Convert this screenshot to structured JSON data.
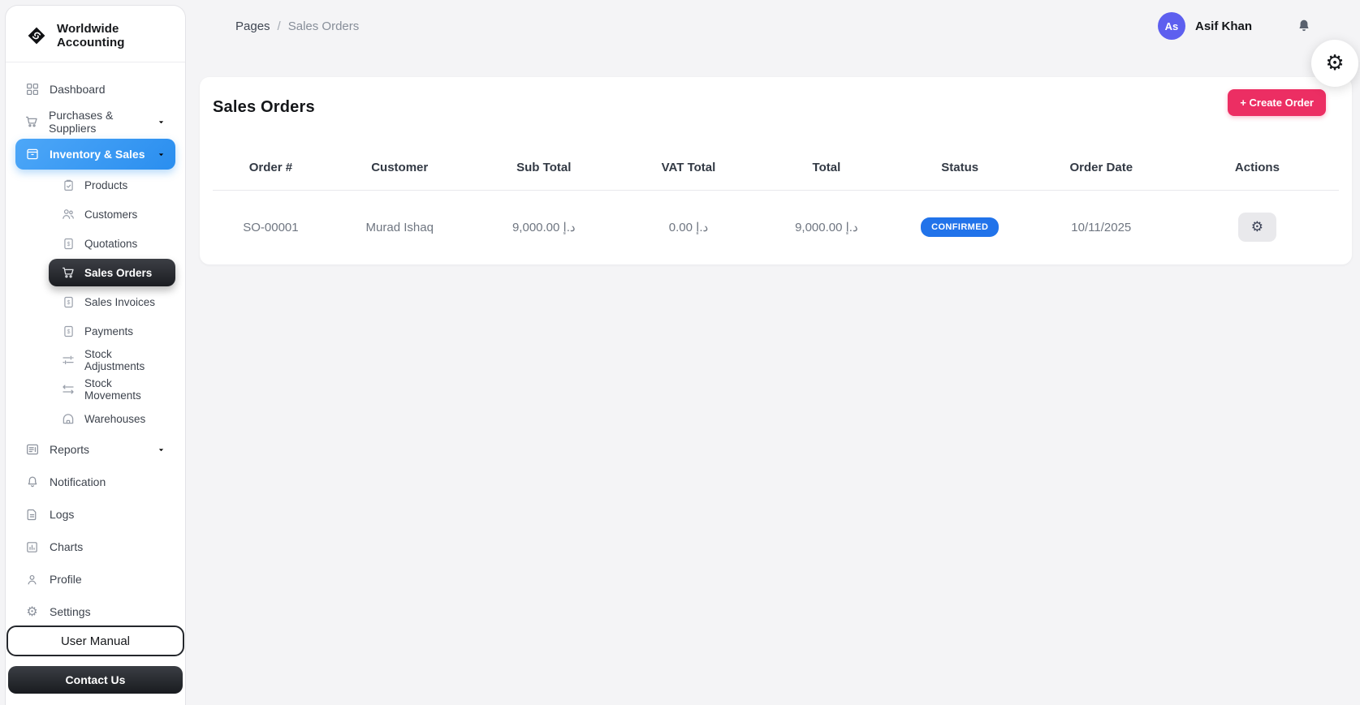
{
  "brand": {
    "name": "Worldwide Accounting"
  },
  "sidebar": {
    "items": [
      {
        "label": "Dashboard",
        "icon": "grid-icon"
      },
      {
        "label": "Purchases & Suppliers",
        "icon": "cart-icon",
        "expandable": true
      },
      {
        "label": "Inventory & Sales",
        "icon": "box-icon",
        "expandable": true,
        "active": true
      },
      {
        "label": "Reports",
        "icon": "report-icon",
        "expandable": true
      },
      {
        "label": "Notification",
        "icon": "bell-icon"
      },
      {
        "label": "Logs",
        "icon": "file-icon"
      },
      {
        "label": "Charts",
        "icon": "chart-icon"
      },
      {
        "label": "Profile",
        "icon": "user-icon"
      },
      {
        "label": "Settings",
        "icon": "gear-icon"
      }
    ],
    "inventory_children": [
      {
        "label": "Products",
        "icon": "clipboard-icon"
      },
      {
        "label": "Customers",
        "icon": "users-icon"
      },
      {
        "label": "Quotations",
        "icon": "invoice-icon"
      },
      {
        "label": "Sales Orders",
        "icon": "sales-cart-icon",
        "active": true
      },
      {
        "label": "Sales Invoices",
        "icon": "invoice-icon"
      },
      {
        "label": "Payments",
        "icon": "invoice-icon"
      },
      {
        "label": "Stock Adjustments",
        "icon": "sliders-icon"
      },
      {
        "label": "Stock Movements",
        "icon": "swap-icon"
      },
      {
        "label": "Warehouses",
        "icon": "warehouse-icon"
      }
    ],
    "user_manual_label": "User Manual",
    "contact_us_label": "Contact Us"
  },
  "topbar": {
    "breadcrumb": {
      "root": "Pages",
      "separator": "/",
      "current": "Sales Orders"
    },
    "user": {
      "initials": "As",
      "name": "Asif Khan"
    }
  },
  "page": {
    "title": "Sales Orders",
    "create_order_label": "+ Create Order"
  },
  "orders_table": {
    "columns": [
      "Order #",
      "Customer",
      "Sub Total",
      "VAT Total",
      "Total",
      "Status",
      "Order Date",
      "Actions"
    ],
    "rows": [
      {
        "order_no": "SO-00001",
        "customer": "Murad Ishaq",
        "sub_total": "9,000.00 د.إ",
        "vat_total": "0.00 د.إ",
        "total": "9,000.00 د.إ",
        "status": "CONFIRMED",
        "order_date": "10/11/2025"
      }
    ]
  },
  "colors": {
    "accent_blue": "#2e96f5",
    "active_dark": "#1d1f23",
    "badge_blue": "#2173ea",
    "create_pink": "#ec2e63",
    "avatar_purple": "#5d5fef",
    "page_bg": "#f4f4f6"
  }
}
